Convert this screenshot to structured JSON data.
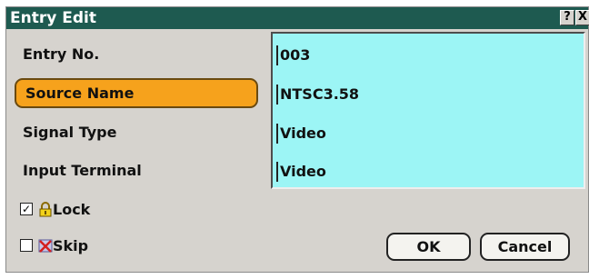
{
  "window": {
    "title": "Entry Edit",
    "help_label": "?",
    "close_label": "X"
  },
  "fields": [
    {
      "label": "Entry No.",
      "value": "003"
    },
    {
      "label": "Source Name",
      "value": "NTSC3.58"
    },
    {
      "label": "Signal Type",
      "value": "Video"
    },
    {
      "label": "Input Terminal",
      "value": "Video"
    }
  ],
  "options": {
    "lock": {
      "label": "Lock",
      "checked": true,
      "check_mark": "✓",
      "icon": "lock-icon"
    },
    "skip": {
      "label": "Skip",
      "checked": false,
      "check_mark": "",
      "icon": "skip-icon"
    }
  },
  "buttons": {
    "ok": "OK",
    "cancel": "Cancel"
  },
  "colors": {
    "titlebar": "#1e5a50",
    "highlight": "#f6a21c",
    "value_panel": "#9cf5f5",
    "dialog": "#d6d3ce"
  }
}
